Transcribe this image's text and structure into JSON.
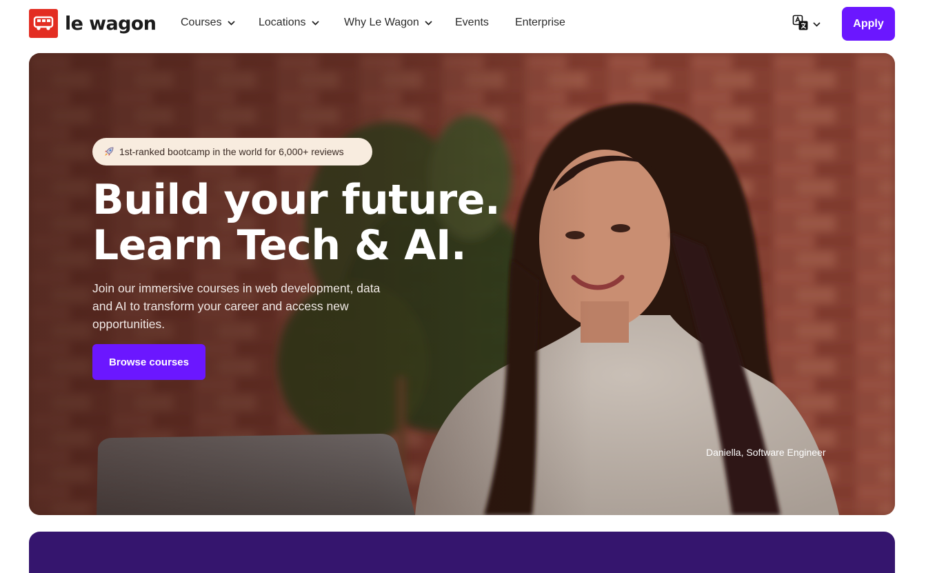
{
  "brand": {
    "name": "le wagon",
    "logo_color": "#e32d22"
  },
  "nav": {
    "items": [
      {
        "label": "Courses",
        "has_dropdown": true
      },
      {
        "label": "Locations",
        "has_dropdown": true
      },
      {
        "label": "Why Le Wagon",
        "has_dropdown": true
      },
      {
        "label": "Events",
        "has_dropdown": false
      },
      {
        "label": "Enterprise",
        "has_dropdown": false
      }
    ],
    "language_icon": "translate-icon",
    "apply_label": "Apply"
  },
  "hero": {
    "badge_icon": "rocket-icon",
    "badge_text": "1st-ranked bootcamp in the world for 6,000+ reviews",
    "headline_line1": "Build your future.",
    "headline_line2": "Learn Tech & AI.",
    "subtext": "Join our immersive courses in web development, data and AI to transform your career and access new opportunities.",
    "cta_label": "Browse courses",
    "photo_caption": "Daniella, Software Engineer"
  },
  "colors": {
    "accent": "#6b17ff",
    "next_section": "#35156e",
    "badge_bg": "#f8ecdf"
  }
}
